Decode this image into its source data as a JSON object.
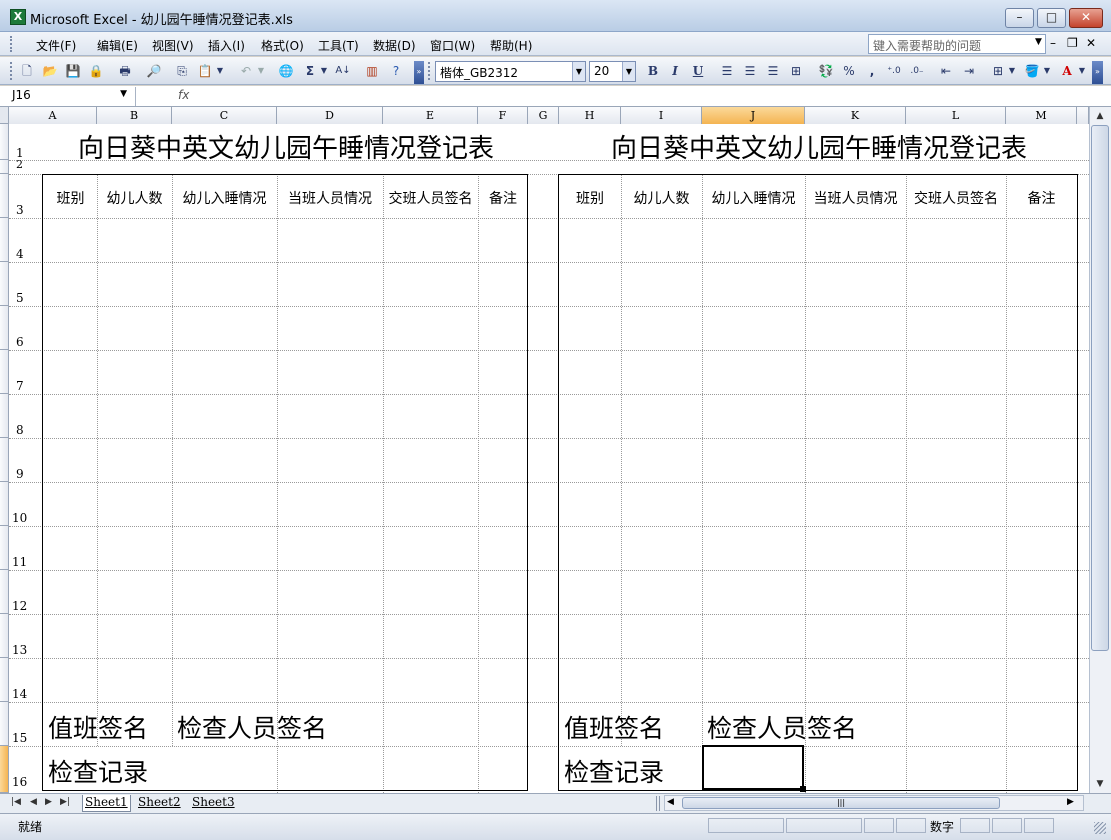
{
  "window": {
    "title": "Microsoft Excel - 幼儿园午睡情况登记表.xls",
    "app_icon": "excel-icon",
    "minimize": "–",
    "maximize": "□",
    "close": "✕"
  },
  "menu": {
    "items": [
      "文件(F)",
      "编辑(E)",
      "视图(V)",
      "插入(I)",
      "格式(O)",
      "工具(T)",
      "数据(D)",
      "窗口(W)",
      "帮助(H)"
    ],
    "help_placeholder": "键入需要帮助的问题",
    "doc_minimize": "–",
    "doc_restore": "❐",
    "doc_close": "✕"
  },
  "toolbar": {
    "font_name": "楷体_GB2312",
    "font_size": "20",
    "bold": "B",
    "italic": "I",
    "underline": "U",
    "percent": "%",
    "comma": ",",
    "sum": "Σ",
    "sort": "A↓"
  },
  "formula_bar": {
    "name_box": "J16",
    "fx": "fx",
    "value": ""
  },
  "columns": [
    "A",
    "B",
    "C",
    "D",
    "E",
    "F",
    "G",
    "H",
    "I",
    "J",
    "K",
    "L",
    "M"
  ],
  "selected_column": "J",
  "rows": [
    "1",
    "2",
    "3",
    "4",
    "5",
    "6",
    "7",
    "8",
    "9",
    "10",
    "11",
    "12",
    "13",
    "14",
    "15",
    "16"
  ],
  "selected_row": "16",
  "sheet": {
    "left_table": {
      "title": "向日葵中英文幼儿园午睡情况登记表",
      "headers": [
        "班别",
        "幼儿人数",
        "幼儿入睡情况",
        "当班人员情况",
        "交班人员签名",
        "备注"
      ],
      "duty_sign": "值班签名",
      "inspector_sign": "检查人员签名",
      "check_record": "检查记录"
    },
    "right_table": {
      "title": "向日葵中英文幼儿园午睡情况登记表",
      "headers": [
        "班别",
        "幼儿人数",
        "幼儿入睡情况",
        "当班人员情况",
        "交班人员签名",
        "备注"
      ],
      "duty_sign": "值班签名",
      "inspector_sign": "检查人员签名",
      "check_record": "检查记录"
    }
  },
  "sheet_tabs": [
    "Sheet1",
    "Sheet2",
    "Sheet3"
  ],
  "active_tab": "Sheet1",
  "status": {
    "left": "就绪",
    "mode": "数字"
  }
}
